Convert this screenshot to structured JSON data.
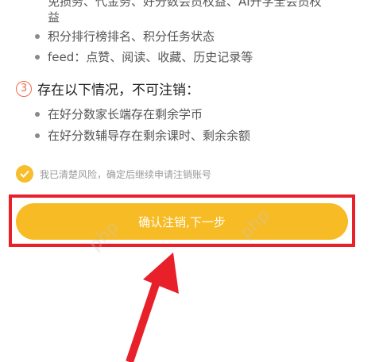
{
  "cutoff_text": {
    "line1": "免损务、代金务、好分数会员权益、AI升学全会员权",
    "line2": "益"
  },
  "section2_bullets": [
    "积分排行榜排名、积分任务状态",
    "feed：点赞、阅读、收藏、历史记录等"
  ],
  "section3": {
    "number": "③",
    "title": "存在以下情况，不可注销：",
    "bullets": [
      "在好分数家长端存在剩余学币",
      "在好分数辅导存在剩余课时、剩余余额"
    ]
  },
  "consent": {
    "text": "我已清楚风险，确定后继续申请注销账号",
    "checked": true
  },
  "confirm_button": {
    "label": "确认注销,下一步"
  },
  "watermark": "php",
  "colors": {
    "accent_yellow": "#f7bb25",
    "highlight_red": "#e8202a",
    "number_orange": "#f06a4c"
  }
}
